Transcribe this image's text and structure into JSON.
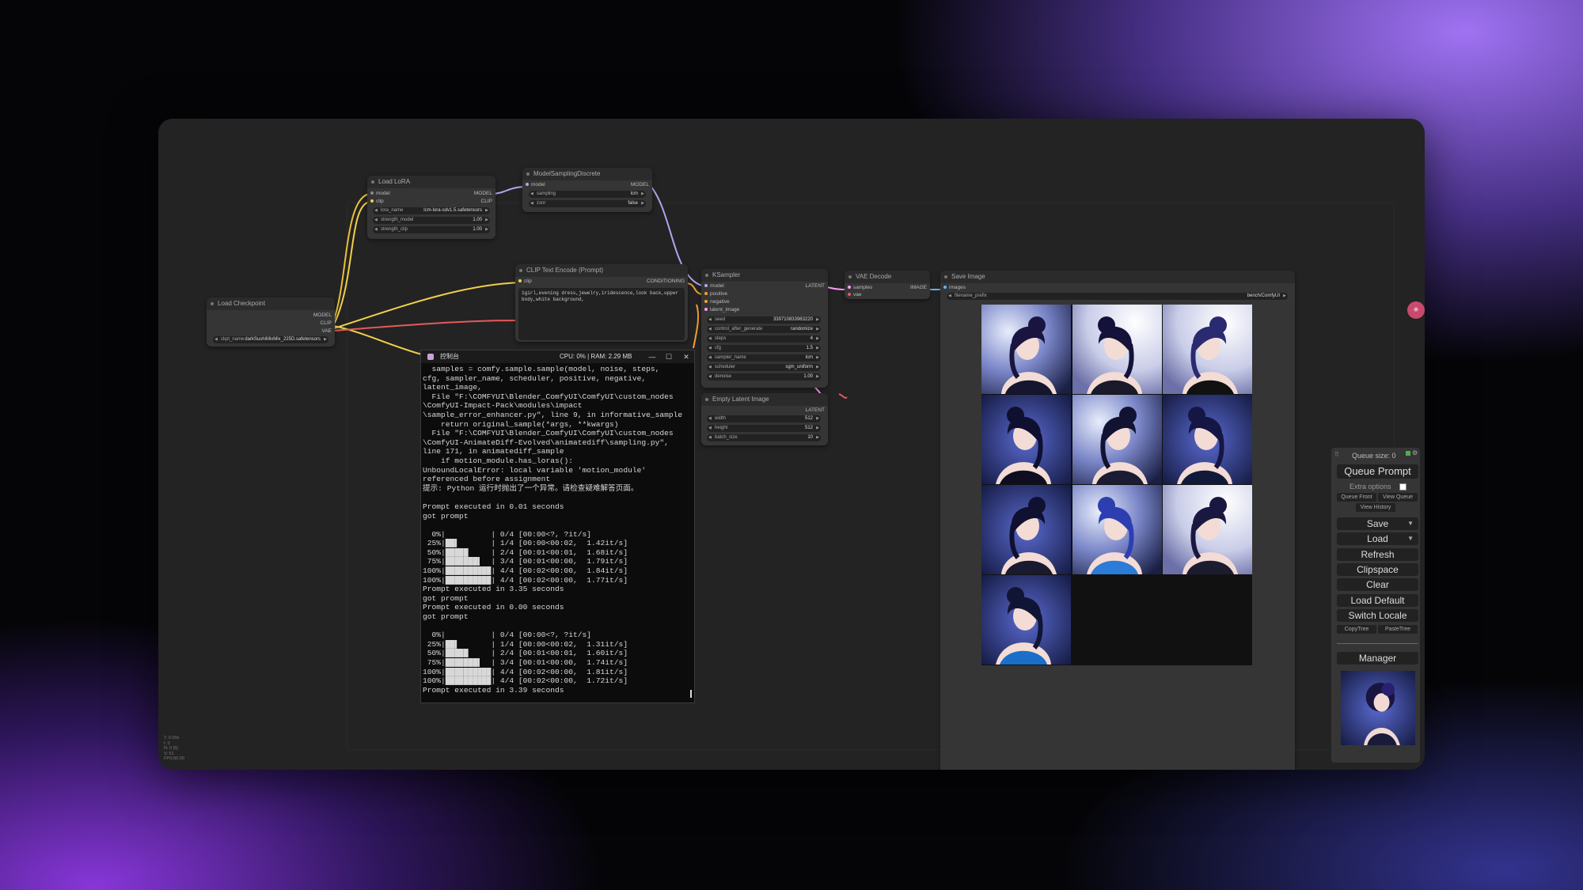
{
  "nodes": {
    "load_lora": {
      "title": "Load LoRA",
      "inputs": [
        "model",
        "clip"
      ],
      "outputs": [
        "MODEL",
        "CLIP"
      ],
      "widgets": [
        {
          "label": "lora_name",
          "value": "lcm-lora-sdv1.5.safetensors"
        },
        {
          "label": "strength_model",
          "value": "1.00"
        },
        {
          "label": "strength_clip",
          "value": "1.00"
        }
      ]
    },
    "model_sampling": {
      "title": "ModelSamplingDiscrete",
      "input": "model",
      "output": "MODEL",
      "widgets": [
        {
          "label": "sampling",
          "value": "lcm"
        },
        {
          "label": "zsnr",
          "value": "false"
        }
      ]
    },
    "load_checkpoint": {
      "title": "Load Checkpoint",
      "outputs": [
        "MODEL",
        "CLIP",
        "VAE"
      ],
      "widgets": [
        {
          "label": "ckpt_name",
          "value": "darkSushiMixMix_225D.safetensors"
        }
      ]
    },
    "clip_text": {
      "title": "CLIP Text Encode (Prompt)",
      "input": "clip",
      "output": "CONDITIONING",
      "text": "1girl,evening dress,jewelry,iridescence,look back,upper body,white background,"
    },
    "ksampler": {
      "title": "KSampler",
      "inputs": [
        "model",
        "positive",
        "negative",
        "latent_image"
      ],
      "output": "LATENT",
      "widgets": [
        {
          "label": "seed",
          "value": "339710833983220"
        },
        {
          "label": "control_after_generate",
          "value": "randomize"
        },
        {
          "label": "steps",
          "value": "4"
        },
        {
          "label": "cfg",
          "value": "1.5"
        },
        {
          "label": "sampler_name",
          "value": "lcm"
        },
        {
          "label": "scheduler",
          "value": "sgm_uniform"
        },
        {
          "label": "denoise",
          "value": "1.00"
        }
      ]
    },
    "empty_latent": {
      "title": "Empty Latent Image",
      "output": "LATENT",
      "widgets": [
        {
          "label": "width",
          "value": "512"
        },
        {
          "label": "height",
          "value": "512"
        },
        {
          "label": "batch_size",
          "value": "10"
        }
      ]
    },
    "vae_decode": {
      "title": "VAE Decode",
      "inputs": [
        "samples",
        "vae"
      ],
      "output": "IMAGE"
    },
    "save_image": {
      "title": "Save Image",
      "input": "images",
      "widgets": [
        {
          "label": "filename_prefix",
          "value": "bench/ComfyUI"
        }
      ]
    }
  },
  "console": {
    "title": "控制台",
    "status": "CPU: 0% | RAM: 2.29 MB",
    "buttons": [
      "—",
      "☐",
      "✕"
    ],
    "text": "  samples = comfy.sample.sample(model, noise, steps,\ncfg, sampler_name, scheduler, positive, negative,\nlatent_image,\n  File \"F:\\COMFYUI\\Blender_ComfyUI\\ComfyUI\\custom_nodes\n\\ComfyUI-Impact-Pack\\modules\\impact\n\\sample_error_enhancer.py\", line 9, in informative_sample\n    return original_sample(*args, **kwargs)\n  File \"F:\\COMFYUI\\Blender_ComfyUI\\ComfyUI\\custom_nodes\n\\ComfyUI-AnimateDiff-Evolved\\animatediff\\sampling.py\",\nline 171, in animatediff_sample\n    if motion_module.has_loras():\nUnboundLocalError: local variable 'motion_module'\nreferenced before assignment\n提示: Python 运行时抛出了一个异常。请检查疑难解答页面。\n\nPrompt executed in 0.01 seconds\ngot prompt\n\n  0%|          | 0/4 [00:00<?, ?it/s]\n 25%|██▌       | 1/4 [00:00<00:02,  1.42it/s]\n 50%|█████     | 2/4 [00:01<00:01,  1.68it/s]\n 75%|███████▌  | 3/4 [00:01<00:00,  1.79it/s]\n100%|██████████| 4/4 [00:02<00:00,  1.84it/s]\n100%|██████████| 4/4 [00:02<00:00,  1.77it/s]\nPrompt executed in 3.35 seconds\ngot prompt\nPrompt executed in 0.00 seconds\ngot prompt\n\n  0%|          | 0/4 [00:00<?, ?it/s]\n 25%|██▌       | 1/4 [00:00<00:02,  1.31it/s]\n 50%|█████     | 2/4 [00:01<00:01,  1.60it/s]\n 75%|███████▌  | 3/4 [00:01<00:00,  1.74it/s]\n100%|██████████| 4/4 [00:02<00:00,  1.81it/s]\n100%|██████████| 4/4 [00:02<00:00,  1.72it/s]\nPrompt executed in 3.39 seconds"
  },
  "gallery_count": 10,
  "queue_panel": {
    "queue_size": "Queue size: 0",
    "queue_prompt": "Queue Prompt",
    "extra_options": "Extra options",
    "queue_front": "Queue Front",
    "view_queue": "View Queue",
    "view_history": "View History",
    "save": "Save",
    "load": "Load",
    "refresh": "Refresh",
    "clipspace": "Clipspace",
    "clear": "Clear",
    "load_default": "Load Default",
    "switch_locale": "Switch Locale",
    "copy_tree": "CopyTree",
    "paste_tree": "PasteTree",
    "manager": "Manager"
  },
  "stats": [
    "T: 0.00s",
    "I: 0",
    "N: 9 [9]",
    "V: 51",
    "FPS:60.00"
  ]
}
